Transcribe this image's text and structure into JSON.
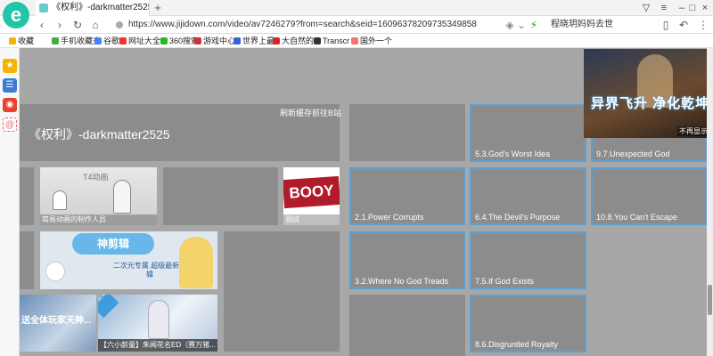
{
  "browser": {
    "tab_title": "《权利》-darkmatter2525正在...",
    "url": "https://www.jijidown.com/video/av7246279?from=search&seid=16096378209735349858",
    "search_text": "程晓玥妈妈去世",
    "bookmarks": [
      "收藏",
      "手机收藏夹",
      "谷歌",
      "网址大全",
      "360搜索",
      "游戏中心",
      "世界上最",
      "大自然的",
      "Transcr",
      "国外一个"
    ]
  },
  "page": {
    "title": "《权利》-darkmatter2525",
    "link_refresh": "刷新缓存",
    "link_bilibili": "前往B站"
  },
  "tiles": {
    "t1": "5.3.God's Worst Idea",
    "t2": "9.7.Unexpected God",
    "t3": "2.1.Power Corrupts",
    "t4": "6.4.The Devil's Purpose",
    "t5": "10.8.You Can't Escape",
    "t6": "3.2.Where No God Treads",
    "t7": "7.5.If God Exists",
    "t8": "8.6.Disgruntled Royalty"
  },
  "thumbs": {
    "th1_label": "T4动画",
    "th1_cap": "简易动画的制作人员",
    "th2_word": "BOOY",
    "th2_cap": "测试",
    "th3_logo": "神剪辑",
    "th3_cap": "二次元专属 超级最新剪辑",
    "th4_cap": "送全体玩家天神...",
    "th5_cap": "【六小龄童】朱闻花名ED（赛万猪...",
    "th6_cap": "神剪辑"
  },
  "ad": {
    "title": "异界飞升 净化乾坤",
    "close": "不再显示"
  }
}
